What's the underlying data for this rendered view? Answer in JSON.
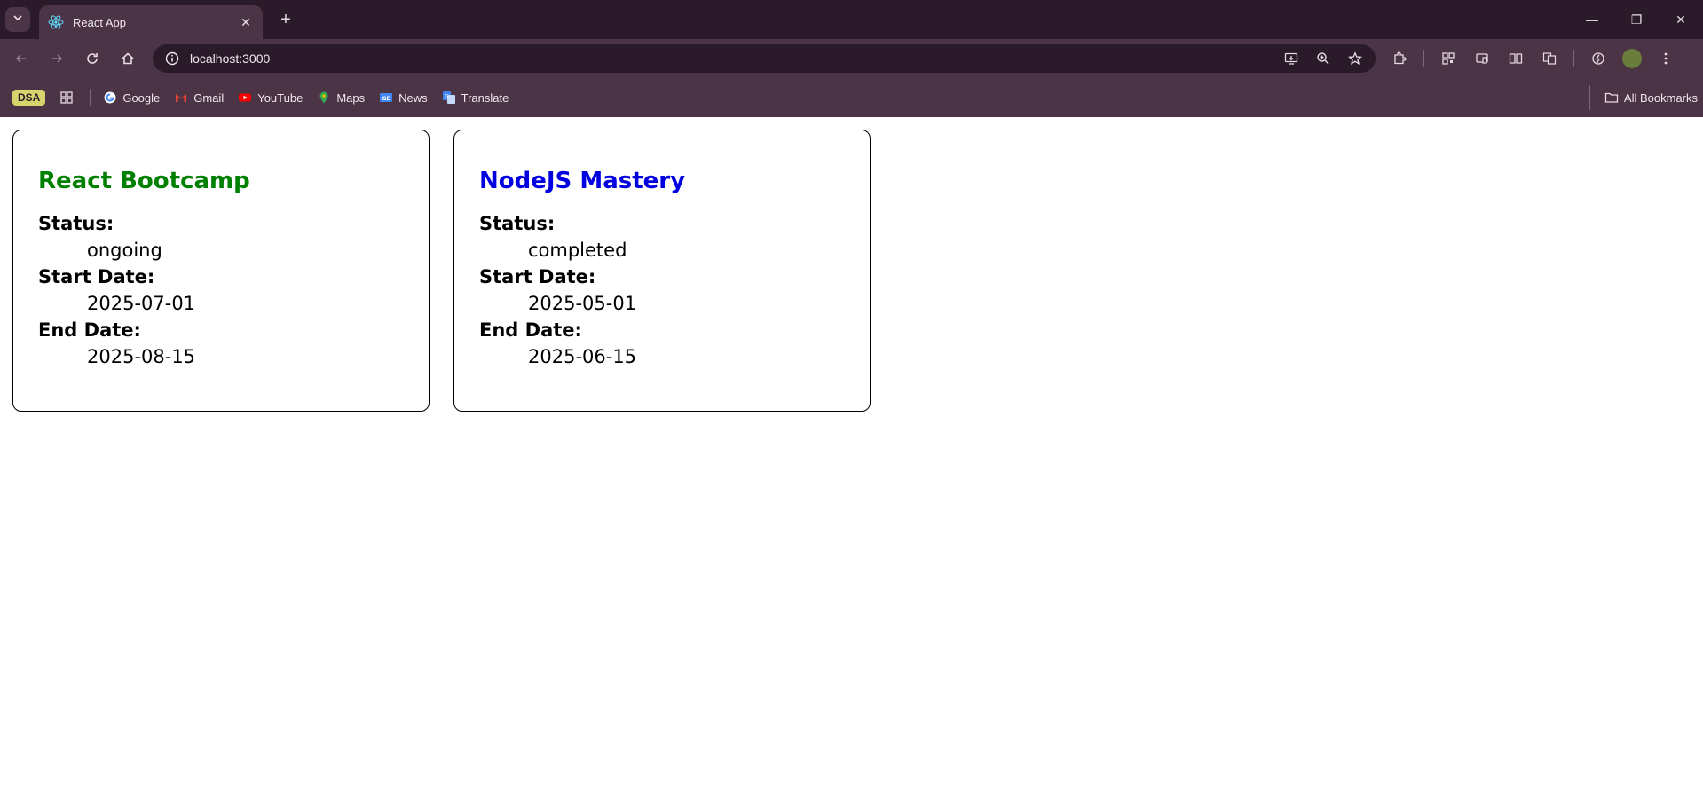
{
  "browser": {
    "tab_title": "React App",
    "url": "localhost:3000",
    "bookmarks": [
      {
        "label": "Google",
        "icon": "google-icon"
      },
      {
        "label": "Gmail",
        "icon": "gmail-icon"
      },
      {
        "label": "YouTube",
        "icon": "youtube-icon"
      },
      {
        "label": "Maps",
        "icon": "maps-icon"
      },
      {
        "label": "News",
        "icon": "news-icon"
      },
      {
        "label": "Translate",
        "icon": "translate-icon"
      }
    ],
    "bookmark_folder_badge": "DSA",
    "all_bookmarks_label": "All Bookmarks"
  },
  "courses": [
    {
      "title": "React Bootcamp",
      "title_color": "#008000",
      "status_label": "Status:",
      "status": "ongoing",
      "start_label": "Start Date:",
      "start": "2025-07-01",
      "end_label": "End Date:",
      "end": "2025-08-15"
    },
    {
      "title": "NodeJS Mastery",
      "title_color": "#0000e0",
      "status_label": "Status:",
      "status": "completed",
      "start_label": "Start Date:",
      "start": "2025-05-01",
      "end_label": "End Date:",
      "end": "2025-06-15"
    }
  ],
  "colors": {
    "tabstrip": "#2b1b2a",
    "toolbar": "#4a3446"
  }
}
